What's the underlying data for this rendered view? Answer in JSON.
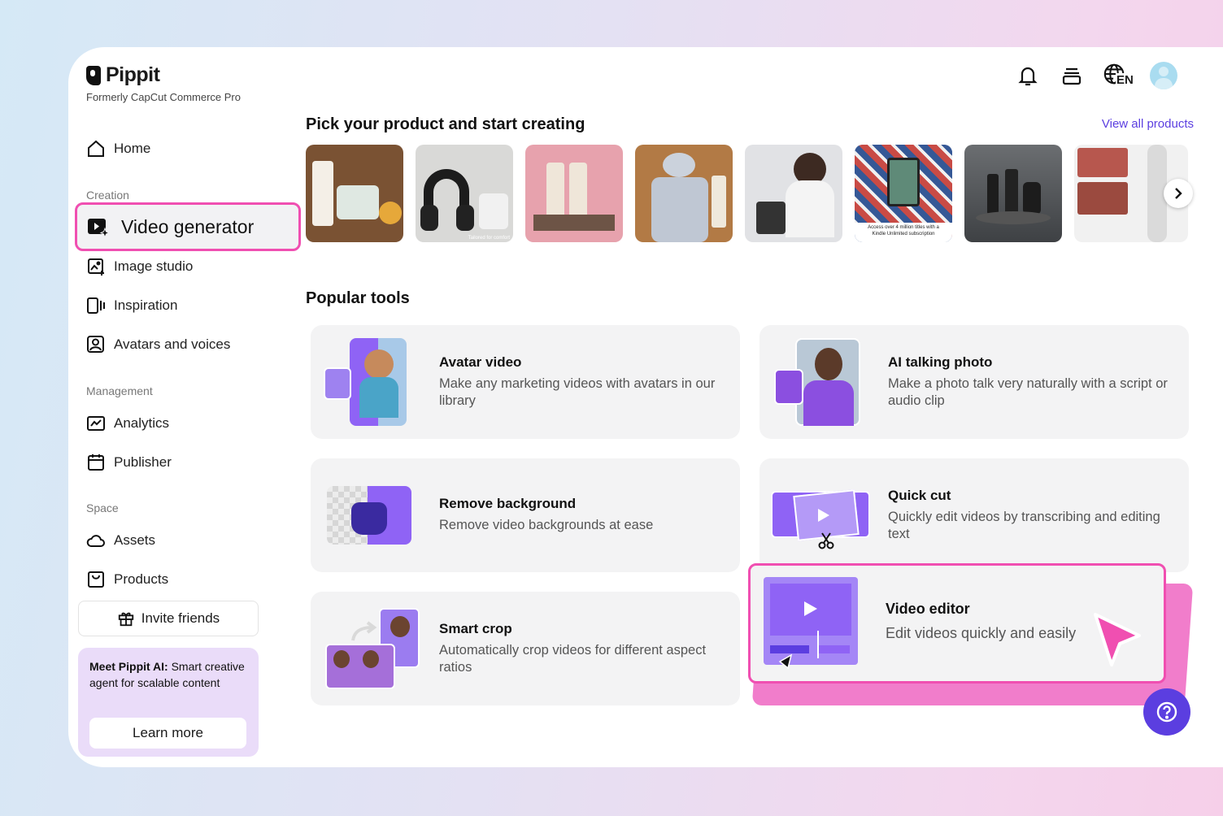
{
  "brand": {
    "name": "Pippit",
    "subtitle": "Formerly CapCut Commerce Pro"
  },
  "sidebar": {
    "home": "Home",
    "creation_label": "Creation",
    "video_generator": "Video generator",
    "image_studio": "Image studio",
    "inspiration": "Inspiration",
    "avatars_voices": "Avatars and voices",
    "management_label": "Management",
    "analytics": "Analytics",
    "publisher": "Publisher",
    "space_label": "Space",
    "assets": "Assets",
    "products": "Products",
    "invite": "Invite friends",
    "promo": {
      "bold": "Meet Pippit AI:",
      "text": " Smart creative agent for scalable content",
      "button": "Learn more"
    }
  },
  "header": {
    "language": "EN"
  },
  "products_section": {
    "title": "Pick your product and start creating",
    "view_all": "View all products",
    "thumbs": [
      {
        "name": "skincare-serum",
        "bg": "#7a5233"
      },
      {
        "name": "headphones",
        "bg": "#d8d8d6"
      },
      {
        "name": "cream-tubes",
        "bg": "#e7a2ad"
      },
      {
        "name": "lotion-stone",
        "bg": "#b27a45"
      },
      {
        "name": "woman-at-desk",
        "bg": "#dcdde0"
      },
      {
        "name": "kindle",
        "bg": "#3a5c9c"
      },
      {
        "name": "dark-bottles",
        "bg": "#4b4e51"
      },
      {
        "name": "sous-vide",
        "bg": "#ececec"
      }
    ],
    "thumb_captions": {
      "kindle": "Access over 4 million titles with a Kindle Unlimited subscription",
      "headphones": "Tailored for comfort"
    }
  },
  "tools_section": {
    "title": "Popular tools",
    "cards": [
      {
        "title": "Avatar video",
        "desc": "Make any marketing videos with avatars in our library"
      },
      {
        "title": "AI talking photo",
        "desc": "Make a photo talk very naturally with a script or audio clip"
      },
      {
        "title": "Remove background",
        "desc": "Remove video backgrounds at ease"
      },
      {
        "title": "Quick cut",
        "desc": "Quickly edit videos by transcribing and editing text"
      },
      {
        "title": "Smart crop",
        "desc": "Automatically crop videos for different aspect ratios"
      },
      {
        "title": "Video editor",
        "desc": "Edit videos quickly and easily"
      }
    ]
  },
  "colors": {
    "accent": "#5b3ee0",
    "highlight": "#f04fb1",
    "card_bg": "#f3f3f4",
    "tool_purple": "#8f63f5"
  }
}
